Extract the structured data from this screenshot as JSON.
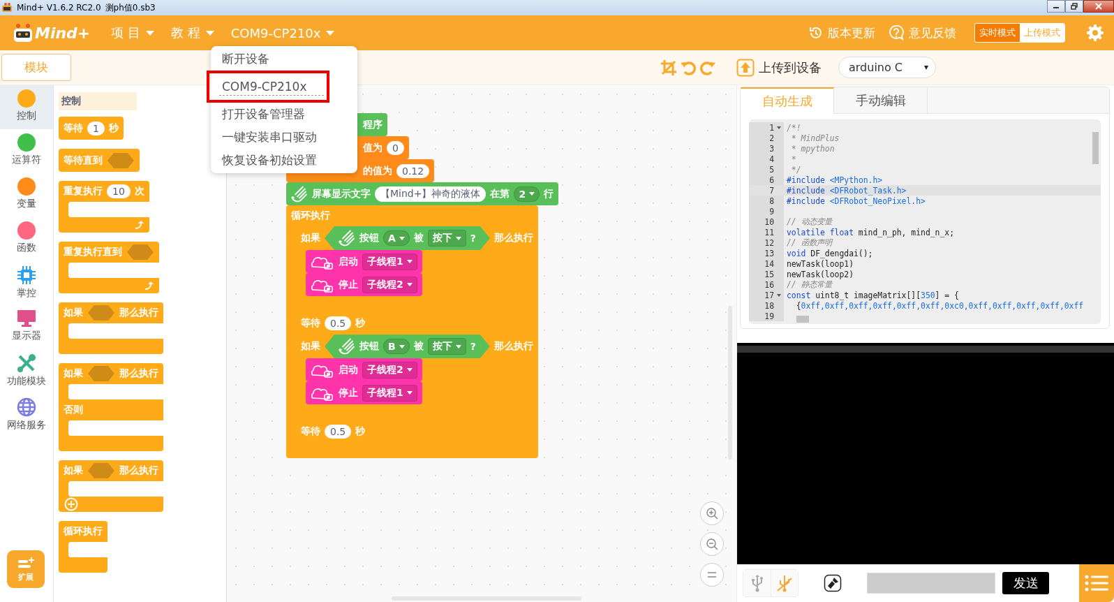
{
  "window": {
    "app_title": "Mind+ V1.6.2 RC2.0",
    "file_name": "测ph值0.sb3"
  },
  "menubar": {
    "logo": "Mind+",
    "menus": [
      {
        "label": "项 目"
      },
      {
        "label": "教 程"
      },
      {
        "label": "COM9-CP210x"
      }
    ],
    "links": [
      {
        "kind": "update",
        "label": "版本更新"
      },
      {
        "kind": "feedback",
        "label": "意见反馈"
      }
    ],
    "modes": [
      {
        "label": "实时模式",
        "selected": false
      },
      {
        "label": "上传模式",
        "selected": true
      }
    ]
  },
  "device_menu": [
    {
      "label": "断开设备",
      "highlighted": false,
      "separator": false
    },
    {
      "label": "COM9-CP210x",
      "highlighted": true,
      "separator": true
    },
    {
      "label": "打开设备管理器",
      "highlighted": false,
      "separator": false
    },
    {
      "label": "一键安装串口驱动",
      "highlighted": false,
      "separator": false
    },
    {
      "label": "恢复设备初始设置",
      "highlighted": false,
      "separator": false
    }
  ],
  "toolbar": {
    "blocks_tab": "模块",
    "upload": "上传到设备",
    "board": "arduino C"
  },
  "categories": [
    {
      "label": "控制",
      "kind": "dot",
      "color": "#ffab19",
      "selected": true
    },
    {
      "label": "运算符",
      "kind": "dot",
      "color": "#40bf4a",
      "selected": false
    },
    {
      "label": "变量",
      "kind": "dot",
      "color": "#ff8c1a",
      "selected": false
    },
    {
      "label": "函数",
      "kind": "dot",
      "color": "#ff6680",
      "selected": false
    },
    {
      "label": "掌控",
      "kind": "chip",
      "color": "#2aa0f0",
      "selected": false
    },
    {
      "label": "显示器",
      "kind": "monitor",
      "color": "#e0508c",
      "selected": false
    },
    {
      "label": "功能模块",
      "kind": "tools",
      "color": "#3cb08a",
      "selected": false
    },
    {
      "label": "网络服务",
      "kind": "globe",
      "color": "#7b7be0",
      "selected": false
    }
  ],
  "extension_button": "扩展",
  "palette": {
    "heading": "控制",
    "blocks": [
      {
        "kind": "command",
        "color": "#ffab19",
        "parts": [
          {
            "kind": "label",
            "text": "等待"
          },
          {
            "kind": "number",
            "text": "1"
          },
          {
            "kind": "label",
            "text": "秒"
          }
        ]
      },
      {
        "kind": "command",
        "color": "#ffab19",
        "parts": [
          {
            "kind": "label",
            "text": "等待直到"
          },
          {
            "kind": "slot"
          }
        ]
      },
      {
        "kind": "c",
        "color": "#ffab19",
        "sections": [
          {
            "parts": [
              {
                "kind": "label",
                "text": "重复执行"
              },
              {
                "kind": "number",
                "text": "10"
              },
              {
                "kind": "label",
                "text": "次"
              }
            ]
          }
        ],
        "end": [
          {
            "kind": "loop"
          }
        ]
      },
      {
        "kind": "c",
        "color": "#ffab19",
        "sections": [
          {
            "parts": [
              {
                "kind": "label",
                "text": "重复执行直到"
              },
              {
                "kind": "slot"
              }
            ]
          }
        ],
        "end": [
          {
            "kind": "loop"
          }
        ]
      },
      {
        "kind": "c",
        "color": "#ffab19",
        "sections": [
          {
            "parts": [
              {
                "kind": "label",
                "text": "如果"
              },
              {
                "kind": "slot"
              },
              {
                "kind": "label",
                "text": "那么执行"
              }
            ]
          }
        ]
      },
      {
        "kind": "c",
        "color": "#ffab19",
        "sections": [
          {
            "parts": [
              {
                "kind": "label",
                "text": "如果"
              },
              {
                "kind": "slot"
              },
              {
                "kind": "label",
                "text": "那么执行"
              }
            ]
          },
          {
            "parts": [
              {
                "kind": "label",
                "text": "否则"
              }
            ]
          }
        ]
      },
      {
        "kind": "c",
        "color": "#ffab19",
        "sections": [
          {
            "parts": [
              {
                "kind": "label",
                "text": "如果"
              },
              {
                "kind": "slot"
              },
              {
                "kind": "label",
                "text": "那么执行"
              }
            ]
          }
        ],
        "end": [
          {
            "kind": "plus"
          }
        ]
      },
      {
        "kind": "c",
        "color": "#ffab19",
        "sections": [
          {
            "parts": [
              {
                "kind": "label",
                "text": "循环执行"
              }
            ]
          }
        ]
      }
    ]
  },
  "script": [
    {
      "kind": "hidden",
      "color": "#59c059",
      "parts": [
        {
          "kind": "label",
          "text": "程序"
        }
      ]
    },
    {
      "kind": "hidden",
      "color": "#ff8c1a",
      "parts": [
        {
          "kind": "label",
          "text": "值为"
        },
        {
          "kind": "number",
          "text": "0"
        }
      ]
    },
    {
      "kind": "hidden",
      "color": "#ff8c1a",
      "parts": [
        {
          "kind": "label",
          "text": "的值为"
        },
        {
          "kind": "number",
          "text": "0.12"
        }
      ]
    },
    {
      "kind": "command",
      "color": "#59c059",
      "parts": [
        {
          "kind": "device"
        },
        {
          "kind": "label",
          "text": "屏幕显示文字"
        },
        {
          "kind": "number",
          "text": "【Mind+】神奇的液体"
        },
        {
          "kind": "label",
          "text": "在第"
        },
        {
          "kind": "dropdown",
          "text": "2"
        },
        {
          "kind": "label",
          "text": "行"
        }
      ]
    },
    {
      "kind": "c",
      "color": "#ffab19",
      "sections": [
        {
          "parts": [
            {
              "kind": "label",
              "text": "循环执行"
            }
          ],
          "body": [
            {
              "kind": "c",
              "color": "#ffab19",
              "sections": [
                {
                  "parts": [
                    {
                      "kind": "label",
                      "text": "如果"
                    },
                    {
                      "kind": "bool",
                      "color": "#59c059",
                      "parts": [
                        {
                          "kind": "device"
                        },
                        {
                          "kind": "label",
                          "text": "按钮"
                        },
                        {
                          "kind": "dropdown",
                          "text": "A"
                        },
                        {
                          "kind": "label",
                          "text": "被"
                        },
                        {
                          "kind": "dropdown",
                          "text": "按下"
                        },
                        {
                          "kind": "label",
                          "text": "?"
                        }
                      ]
                    },
                    {
                      "kind": "label",
                      "text": "那么执行"
                    }
                  ],
                  "body": [
                    {
                      "kind": "command",
                      "color": "#ff33aa",
                      "parts": [
                        {
                          "kind": "thread"
                        },
                        {
                          "kind": "label",
                          "text": "启动"
                        },
                        {
                          "kind": "dropdown",
                          "text": "子线程1"
                        }
                      ]
                    },
                    {
                      "kind": "command",
                      "color": "#ff33aa",
                      "parts": [
                        {
                          "kind": "thread"
                        },
                        {
                          "kind": "label",
                          "text": "停止"
                        },
                        {
                          "kind": "dropdown",
                          "text": "子线程2"
                        }
                      ]
                    }
                  ]
                }
              ]
            },
            {
              "kind": "command",
              "color": "#ffab19",
              "parts": [
                {
                  "kind": "label",
                  "text": "等待"
                },
                {
                  "kind": "number",
                  "text": "0.5"
                },
                {
                  "kind": "label",
                  "text": "秒"
                }
              ]
            },
            {
              "kind": "c",
              "color": "#ffab19",
              "sections": [
                {
                  "parts": [
                    {
                      "kind": "label",
                      "text": "如果"
                    },
                    {
                      "kind": "bool",
                      "color": "#59c059",
                      "parts": [
                        {
                          "kind": "device"
                        },
                        {
                          "kind": "label",
                          "text": "按钮"
                        },
                        {
                          "kind": "dropdown",
                          "text": "B"
                        },
                        {
                          "kind": "label",
                          "text": "被"
                        },
                        {
                          "kind": "dropdown",
                          "text": "按下"
                        },
                        {
                          "kind": "label",
                          "text": "?"
                        }
                      ]
                    },
                    {
                      "kind": "label",
                      "text": "那么执行"
                    }
                  ],
                  "body": [
                    {
                      "kind": "command",
                      "color": "#ff33aa",
                      "parts": [
                        {
                          "kind": "thread"
                        },
                        {
                          "kind": "label",
                          "text": "启动"
                        },
                        {
                          "kind": "dropdown",
                          "text": "子线程2"
                        }
                      ]
                    },
                    {
                      "kind": "command",
                      "color": "#ff33aa",
                      "parts": [
                        {
                          "kind": "thread"
                        },
                        {
                          "kind": "label",
                          "text": "停止"
                        },
                        {
                          "kind": "dropdown",
                          "text": "子线程1"
                        }
                      ]
                    }
                  ]
                }
              ]
            },
            {
              "kind": "command",
              "color": "#ffab19",
              "parts": [
                {
                  "kind": "label",
                  "text": "等待"
                },
                {
                  "kind": "number",
                  "text": "0.5"
                },
                {
                  "kind": "label",
                  "text": "秒"
                }
              ]
            }
          ]
        }
      ]
    }
  ],
  "code_tabs": [
    {
      "label": "自动生成",
      "selected": true
    },
    {
      "label": "手动编辑",
      "selected": false
    }
  ],
  "code_lines": [
    {
      "n": "1",
      "fold": true,
      "current": false,
      "parts": [
        {
          "kind": "comment",
          "text": "/*!"
        }
      ]
    },
    {
      "n": "2",
      "fold": false,
      "current": false,
      "parts": [
        {
          "kind": "comment",
          "text": " * MindPlus"
        }
      ]
    },
    {
      "n": "3",
      "fold": false,
      "current": false,
      "parts": [
        {
          "kind": "comment",
          "text": " * mpython"
        }
      ]
    },
    {
      "n": "4",
      "fold": false,
      "current": false,
      "parts": [
        {
          "kind": "comment",
          "text": " *"
        }
      ]
    },
    {
      "n": "5",
      "fold": false,
      "current": false,
      "parts": [
        {
          "kind": "comment",
          "text": " */"
        }
      ]
    },
    {
      "n": "6",
      "fold": false,
      "current": false,
      "parts": [
        {
          "kind": "keyword",
          "text": "#include"
        },
        {
          "kind": "string",
          "text": " <MPython.h>"
        }
      ]
    },
    {
      "n": "7",
      "fold": false,
      "current": true,
      "parts": [
        {
          "kind": "keyword",
          "text": "#include"
        },
        {
          "kind": "string",
          "text": " <DFRobot_Task.h>"
        }
      ]
    },
    {
      "n": "8",
      "fold": false,
      "current": false,
      "parts": [
        {
          "kind": "keyword",
          "text": "#include"
        },
        {
          "kind": "string",
          "text": " <DFRobot_NeoPixel.h>"
        }
      ]
    },
    {
      "n": "9",
      "fold": false,
      "current": false
    },
    {
      "n": "10",
      "fold": false,
      "current": false,
      "parts": [
        {
          "kind": "comment",
          "text": "// 动态变量"
        }
      ]
    },
    {
      "n": "11",
      "fold": false,
      "current": false,
      "parts": [
        {
          "kind": "keyword",
          "text": "volatile float"
        },
        {
          "kind": "plain",
          "text": " mind_n_ph, mind_n_x;"
        }
      ]
    },
    {
      "n": "12",
      "fold": false,
      "current": false,
      "parts": [
        {
          "kind": "comment",
          "text": "// 函数声明"
        }
      ]
    },
    {
      "n": "13",
      "fold": false,
      "current": false,
      "parts": [
        {
          "kind": "keyword",
          "text": "void"
        },
        {
          "kind": "plain",
          "text": " DF_dengdai();"
        }
      ]
    },
    {
      "n": "14",
      "fold": false,
      "current": false,
      "parts": [
        {
          "kind": "plain",
          "text": "newTask(loop1)"
        }
      ]
    },
    {
      "n": "15",
      "fold": false,
      "current": false,
      "parts": [
        {
          "kind": "plain",
          "text": "newTask(loop2)"
        }
      ]
    },
    {
      "n": "16",
      "fold": false,
      "current": false,
      "parts": [
        {
          "kind": "comment",
          "text": "// 静态常量"
        }
      ]
    },
    {
      "n": "17",
      "fold": true,
      "current": false,
      "parts": [
        {
          "kind": "keyword",
          "text": "const"
        },
        {
          "kind": "plain",
          "text": " uint8_t imageMatrix[]["
        },
        {
          "kind": "string",
          "text": "350"
        },
        {
          "kind": "plain",
          "text": "] = {"
        }
      ]
    },
    {
      "n": "18",
      "fold": false,
      "current": false,
      "parts": [
        {
          "kind": "plain",
          "text": "  {"
        },
        {
          "kind": "string",
          "text": "0xff,0xff,0xff,0xff,0xff,0xff,0xc0,0xff,0xff,0xff,0xff,0xff"
        }
      ]
    },
    {
      "n": "19",
      "fold": false,
      "current": false
    }
  ],
  "serial": {
    "send": "发送"
  }
}
